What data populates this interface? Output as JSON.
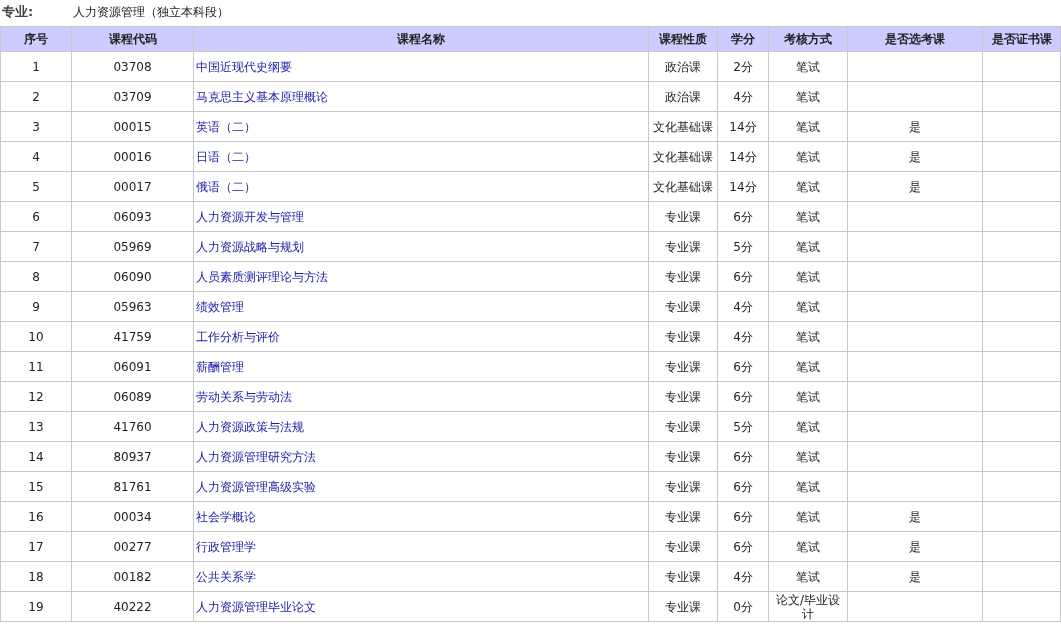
{
  "major": {
    "label": "专业:",
    "value": "人力资源管理（独立本科段）"
  },
  "table": {
    "columns": [
      "序号",
      "课程代码",
      "课程名称",
      "课程性质",
      "学分",
      "考核方式",
      "是否选考课",
      "是否证书课"
    ],
    "rows": [
      {
        "no": "1",
        "code": "03708",
        "name": "中国近现代史纲要",
        "type": "政治课",
        "credit": "2分",
        "exam": "笔试",
        "elective": "",
        "certificate": ""
      },
      {
        "no": "2",
        "code": "03709",
        "name": "马克思主义基本原理概论",
        "type": "政治课",
        "credit": "4分",
        "exam": "笔试",
        "elective": "",
        "certificate": ""
      },
      {
        "no": "3",
        "code": "00015",
        "name": "英语（二）",
        "type": "文化基础课",
        "credit": "14分",
        "exam": "笔试",
        "elective": "是",
        "certificate": ""
      },
      {
        "no": "4",
        "code": "00016",
        "name": "日语（二）",
        "type": "文化基础课",
        "credit": "14分",
        "exam": "笔试",
        "elective": "是",
        "certificate": ""
      },
      {
        "no": "5",
        "code": "00017",
        "name": "俄语（二）",
        "type": "文化基础课",
        "credit": "14分",
        "exam": "笔试",
        "elective": "是",
        "certificate": ""
      },
      {
        "no": "6",
        "code": "06093",
        "name": "人力资源开发与管理",
        "type": "专业课",
        "credit": "6分",
        "exam": "笔试",
        "elective": "",
        "certificate": ""
      },
      {
        "no": "7",
        "code": "05969",
        "name": "人力资源战略与规划",
        "type": "专业课",
        "credit": "5分",
        "exam": "笔试",
        "elective": "",
        "certificate": ""
      },
      {
        "no": "8",
        "code": "06090",
        "name": "人员素质测评理论与方法",
        "type": "专业课",
        "credit": "6分",
        "exam": "笔试",
        "elective": "",
        "certificate": ""
      },
      {
        "no": "9",
        "code": "05963",
        "name": "绩效管理",
        "type": "专业课",
        "credit": "4分",
        "exam": "笔试",
        "elective": "",
        "certificate": ""
      },
      {
        "no": "10",
        "code": "41759",
        "name": "工作分析与评价",
        "type": "专业课",
        "credit": "4分",
        "exam": "笔试",
        "elective": "",
        "certificate": ""
      },
      {
        "no": "11",
        "code": "06091",
        "name": "薪酬管理",
        "type": "专业课",
        "credit": "6分",
        "exam": "笔试",
        "elective": "",
        "certificate": ""
      },
      {
        "no": "12",
        "code": "06089",
        "name": "劳动关系与劳动法",
        "type": "专业课",
        "credit": "6分",
        "exam": "笔试",
        "elective": "",
        "certificate": ""
      },
      {
        "no": "13",
        "code": "41760",
        "name": "人力资源政策与法规",
        "type": "专业课",
        "credit": "5分",
        "exam": "笔试",
        "elective": "",
        "certificate": ""
      },
      {
        "no": "14",
        "code": "80937",
        "name": "人力资源管理研究方法",
        "type": "专业课",
        "credit": "6分",
        "exam": "笔试",
        "elective": "",
        "certificate": ""
      },
      {
        "no": "15",
        "code": "81761",
        "name": "人力资源管理高级实验",
        "type": "专业课",
        "credit": "6分",
        "exam": "笔试",
        "elective": "",
        "certificate": ""
      },
      {
        "no": "16",
        "code": "00034",
        "name": "社会学概论",
        "type": "专业课",
        "credit": "6分",
        "exam": "笔试",
        "elective": "是",
        "certificate": ""
      },
      {
        "no": "17",
        "code": "00277",
        "name": "行政管理学",
        "type": "专业课",
        "credit": "6分",
        "exam": "笔试",
        "elective": "是",
        "certificate": ""
      },
      {
        "no": "18",
        "code": "00182",
        "name": "公共关系学",
        "type": "专业课",
        "credit": "4分",
        "exam": "笔试",
        "elective": "是",
        "certificate": ""
      },
      {
        "no": "19",
        "code": "40222",
        "name": "人力资源管理毕业论文",
        "type": "专业课",
        "credit": "0分",
        "exam": "论文/毕业设计",
        "elective": "",
        "certificate": ""
      }
    ]
  }
}
